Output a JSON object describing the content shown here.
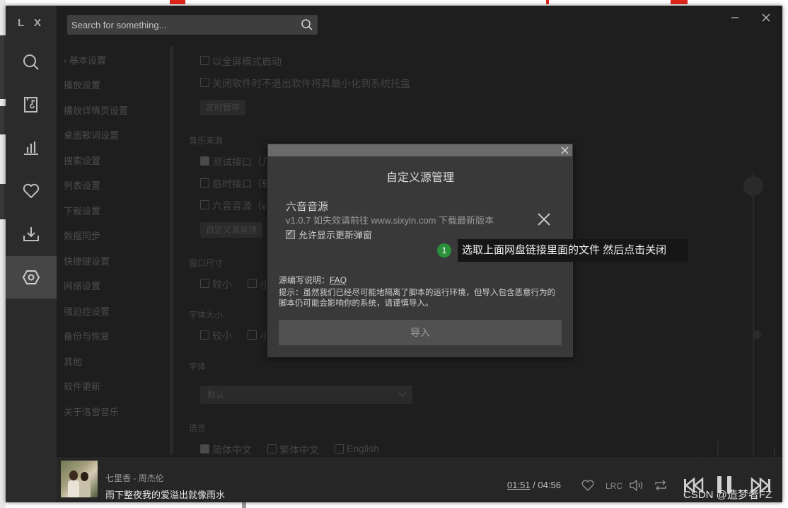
{
  "app": {
    "logo": "L X",
    "search_placeholder": "Search for something..."
  },
  "nav_icons": [
    "search-icon",
    "music-file-icon",
    "chart-icon",
    "heart-icon",
    "download-icon",
    "settings-hex-icon"
  ],
  "settings_nav": {
    "items": [
      {
        "label": "› 基本设置"
      },
      {
        "label": "播放设置"
      },
      {
        "label": "播放详情页设置"
      },
      {
        "label": "桌面歌词设置"
      },
      {
        "label": "搜索设置"
      },
      {
        "label": "列表设置"
      },
      {
        "label": "下载设置"
      },
      {
        "label": "数据同步"
      },
      {
        "label": "快捷键设置"
      },
      {
        "label": "网络设置"
      },
      {
        "label": "强迫症设置"
      },
      {
        "label": "备份与恢复"
      },
      {
        "label": "其他"
      },
      {
        "label": "软件更新"
      },
      {
        "label": "关于洛雪音乐"
      }
    ]
  },
  "content": {
    "opt_fullscreen": "以全屏模式启动",
    "opt_tray": "关闭软件时不退出软件将其最小化到系统托盘",
    "timer_btn": "定时暂停",
    "music_source_heading": "音乐来源",
    "source_test": "测试接口（几",
    "source_temp": "临时接口（软",
    "source_liuyin": "六音音源（v1",
    "custom_source_btn": "自定义源管理",
    "window_size_heading": "窗口尺寸",
    "size_smaller": "较小",
    "size_small": "小",
    "font_size_heading": "字体大小",
    "font_smaller": "较小",
    "font_small": "小",
    "font_heading": "字体",
    "font_select_value": "默认",
    "language_heading": "语言",
    "lang_zh_cn": "简体中文",
    "lang_zh_tw": "繁体中文",
    "lang_en": "English"
  },
  "modal": {
    "title": "自定义源管理",
    "source_name": "六音音源",
    "source_desc": "v1.0.7 如失效请前往 www.sixyin.com 下载最新版本",
    "allow_update_popup": "允许显示更新弹窗",
    "allow_update_checked": true,
    "note_prefix": "源编写说明：",
    "note_link": "FAQ",
    "tip": "提示：虽然我们已经尽可能地隔离了脚本的运行环境，但导入包含恶意行为的脚本仍可能会影响你的系统，请谨慎导入。",
    "import_button": "导入"
  },
  "annotation": {
    "number": "1",
    "text": "选取上面网盘链接里面的文件 然后点击关闭"
  },
  "player": {
    "song": "七里香 - 周杰伦",
    "lyric": "雨下整夜我的爱溢出就像雨水",
    "current_time": "01:51",
    "separator": " / ",
    "total_time": "04:56",
    "lrc_label": "LRC"
  },
  "watermark": "CSDN @造梦者FZ",
  "colors": {
    "accent_green": "#2b8f3b",
    "background": "#1e1e1e"
  }
}
